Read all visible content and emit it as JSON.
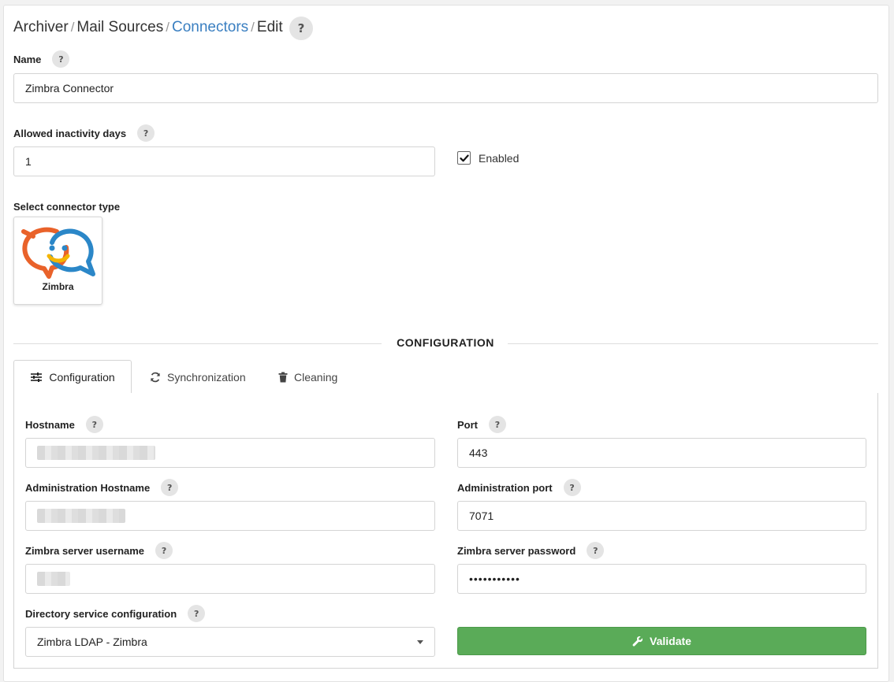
{
  "breadcrumb": {
    "items": [
      "Archiver",
      "Mail Sources",
      "Connectors",
      "Edit"
    ],
    "separator": "/",
    "help": "?"
  },
  "help_glyph": "?",
  "name_field": {
    "label": "Name",
    "value": "Zimbra Connector"
  },
  "inactivity_field": {
    "label": "Allowed inactivity days",
    "value": "1"
  },
  "enabled_checkbox": {
    "label": "Enabled",
    "checked": true
  },
  "connector_type": {
    "label": "Select connector type",
    "selected": "Zimbra",
    "icon": "zimbra-logo"
  },
  "section_title": "CONFIGURATION",
  "tabs": [
    {
      "label": "Configuration",
      "icon": "sliders-icon",
      "active": true
    },
    {
      "label": "Synchronization",
      "icon": "refresh-icon",
      "active": false
    },
    {
      "label": "Cleaning",
      "icon": "trash-icon",
      "active": false
    }
  ],
  "config": {
    "hostname": {
      "label": "Hostname",
      "value": ""
    },
    "port": {
      "label": "Port",
      "value": "443"
    },
    "admin_hostname": {
      "label": "Administration Hostname",
      "value": ""
    },
    "admin_port": {
      "label": "Administration port",
      "value": "7071"
    },
    "username": {
      "label": "Zimbra server username",
      "value": ""
    },
    "password": {
      "label": "Zimbra server password",
      "value": "•••••••••••"
    },
    "directory": {
      "label": "Directory service configuration",
      "value": "Zimbra LDAP - Zimbra"
    },
    "validate_label": "Validate",
    "validate_icon": "wrench-icon"
  },
  "colors": {
    "link": "#3a7fc1",
    "validate_bg": "#5aab58",
    "zimbra_orange": "#e9622a",
    "zimbra_blue": "#2b87c8"
  }
}
